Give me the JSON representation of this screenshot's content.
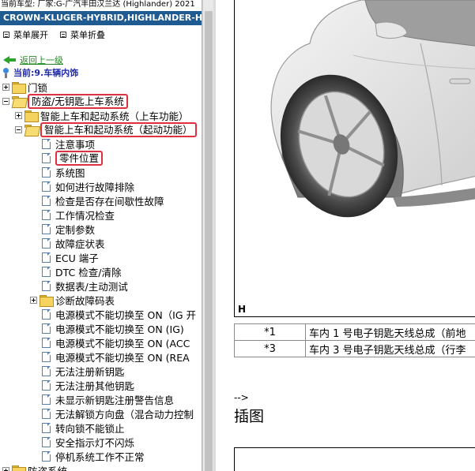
{
  "header": {
    "vehicle_line": "当前车型:  厂家:G-广汽丰田汉兰达 (Highlander) 2021",
    "model": "CROWN-KLUGER-HYBRID,HIGHLANDER-HYBRID"
  },
  "menu_controls": {
    "expand_label": "菜单展开",
    "collapse_label": "菜单折叠"
  },
  "nav": {
    "back_label": "返回上一级",
    "current_label": "当前:9.车辆内饰"
  },
  "tree": [
    {
      "label": "门锁",
      "kind": "folder",
      "expander": "plus"
    },
    {
      "label": "防盗/无钥匙上车系统",
      "kind": "folder-open",
      "expander": "minus",
      "highlight": true
    },
    {
      "label": "智能上车和起动系统（上车功能）",
      "kind": "folder",
      "expander": "plus"
    },
    {
      "label": "智能上车和起动系统（起动功能）",
      "kind": "folder-open",
      "expander": "minus",
      "highlight": true
    },
    {
      "label": "注意事项",
      "kind": "doc"
    },
    {
      "label": "零件位置",
      "kind": "doc",
      "highlight": true
    },
    {
      "label": "系统图",
      "kind": "doc"
    },
    {
      "label": "如何进行故障排除",
      "kind": "doc"
    },
    {
      "label": "检查是否存在间歇性故障",
      "kind": "doc"
    },
    {
      "label": "工作情况检查",
      "kind": "doc"
    },
    {
      "label": "定制参数",
      "kind": "doc"
    },
    {
      "label": "故障症状表",
      "kind": "doc"
    },
    {
      "label": "ECU 端子",
      "kind": "doc"
    },
    {
      "label": "DTC 检查/清除",
      "kind": "doc"
    },
    {
      "label": "数据表/主动测试",
      "kind": "doc"
    },
    {
      "label": "诊断故障码表",
      "kind": "folder",
      "expander": "plus"
    },
    {
      "label": "电源模式不能切换至 ON（IG 开",
      "kind": "doc"
    },
    {
      "label": "电源模式不能切换至 ON (IG)",
      "kind": "doc"
    },
    {
      "label": "电源模式不能切换至 ON (ACC",
      "kind": "doc"
    },
    {
      "label": "电源模式不能切换至 ON (REA",
      "kind": "doc"
    },
    {
      "label": "无法注册新钥匙",
      "kind": "doc"
    },
    {
      "label": "无法注册其他钥匙",
      "kind": "doc"
    },
    {
      "label": "未显示新钥匙注册警告信息",
      "kind": "doc"
    },
    {
      "label": "无法解锁方向盘（混合动力控制",
      "kind": "doc"
    },
    {
      "label": "转向锁不能锁止",
      "kind": "doc"
    },
    {
      "label": "安全指示灯不闪烁",
      "kind": "doc"
    },
    {
      "label": "停机系统工作不正常",
      "kind": "doc"
    },
    {
      "label": "防盗系统",
      "kind": "folder",
      "expander": "plus"
    }
  ],
  "content": {
    "figure_label": "H",
    "legend_rows": [
      {
        "num": "*1",
        "desc": "车内 1 号电子钥匙天线总成（前地"
      },
      {
        "num": "*3",
        "desc": "车内 3 号电子钥匙天线总成（行李"
      }
    ],
    "comment_text": "-->",
    "section_title": "插图"
  },
  "colors": {
    "model_bar": "#1f5a91",
    "highlight_border": "#e0303f",
    "back_link": "#1e8a1e",
    "current_text": "#1f2aa8"
  }
}
